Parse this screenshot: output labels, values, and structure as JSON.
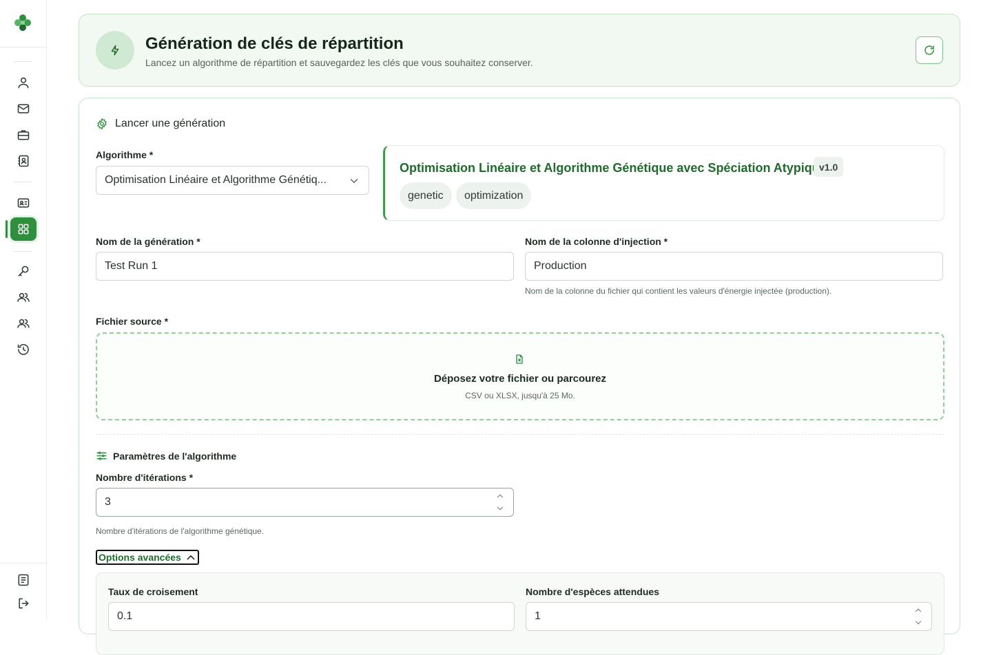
{
  "sidebar": {
    "items": [
      {
        "icon": "user-icon"
      },
      {
        "icon": "mail-icon"
      },
      {
        "icon": "briefcase-icon"
      },
      {
        "icon": "contact-book-icon"
      },
      {
        "icon": "id-card-icon"
      },
      {
        "icon": "grid-icon",
        "active": true
      },
      {
        "icon": "key-icon"
      },
      {
        "icon": "users-icon"
      },
      {
        "icon": "team-icon"
      },
      {
        "icon": "history-icon"
      }
    ],
    "bottom": [
      {
        "icon": "document-icon"
      },
      {
        "icon": "logout-icon"
      }
    ]
  },
  "header": {
    "title": "Génération de clés de répartition",
    "subtitle": "Lancez un algorithme de répartition et sauvegardez les clés que vous souhaitez conserver.",
    "refresh_icon": "refresh-icon"
  },
  "form": {
    "section_title": "Lancer une génération",
    "algorithm": {
      "label": "Algorithme *",
      "value": "Optimisation Linéaire et Algorithme Génétiq..."
    },
    "algorithm_info": {
      "name": "Optimisation Linéaire et Algorithme Génétique avec Spéciation Atypique",
      "version": "v1.0",
      "tags": [
        "genetic",
        "optimization"
      ]
    },
    "generation_name": {
      "label": "Nom de la génération *",
      "value": "Test Run 1"
    },
    "injection_column": {
      "label": "Nom de la colonne d'injection *",
      "value": "Production",
      "help": "Nom de la colonne du fichier qui contient les valeurs d'énergie injectée (production)."
    },
    "source_file": {
      "label": "Fichier source *",
      "drop_title": "Déposez votre fichier ou parcourez",
      "drop_hint": "CSV ou XLSX, jusqu'à 25 Mo."
    },
    "params_title": "Paramètres de l'algorithme",
    "iterations": {
      "label": "Nombre d'itérations *",
      "value": "3",
      "help": "Nombre d'itérations de l'algorithme génétique."
    },
    "advanced_toggle": "Options avancées",
    "crossover_rate": {
      "label": "Taux de croisement",
      "value": "0.1"
    },
    "species_count": {
      "label": "Nombre d'espèces attendues",
      "value": "1"
    }
  },
  "colors": {
    "accent": "#2e8f3c",
    "accent_dark": "#1f6b2b",
    "header_bg": "#f1f9f2",
    "border_green": "#c6e3c9"
  }
}
